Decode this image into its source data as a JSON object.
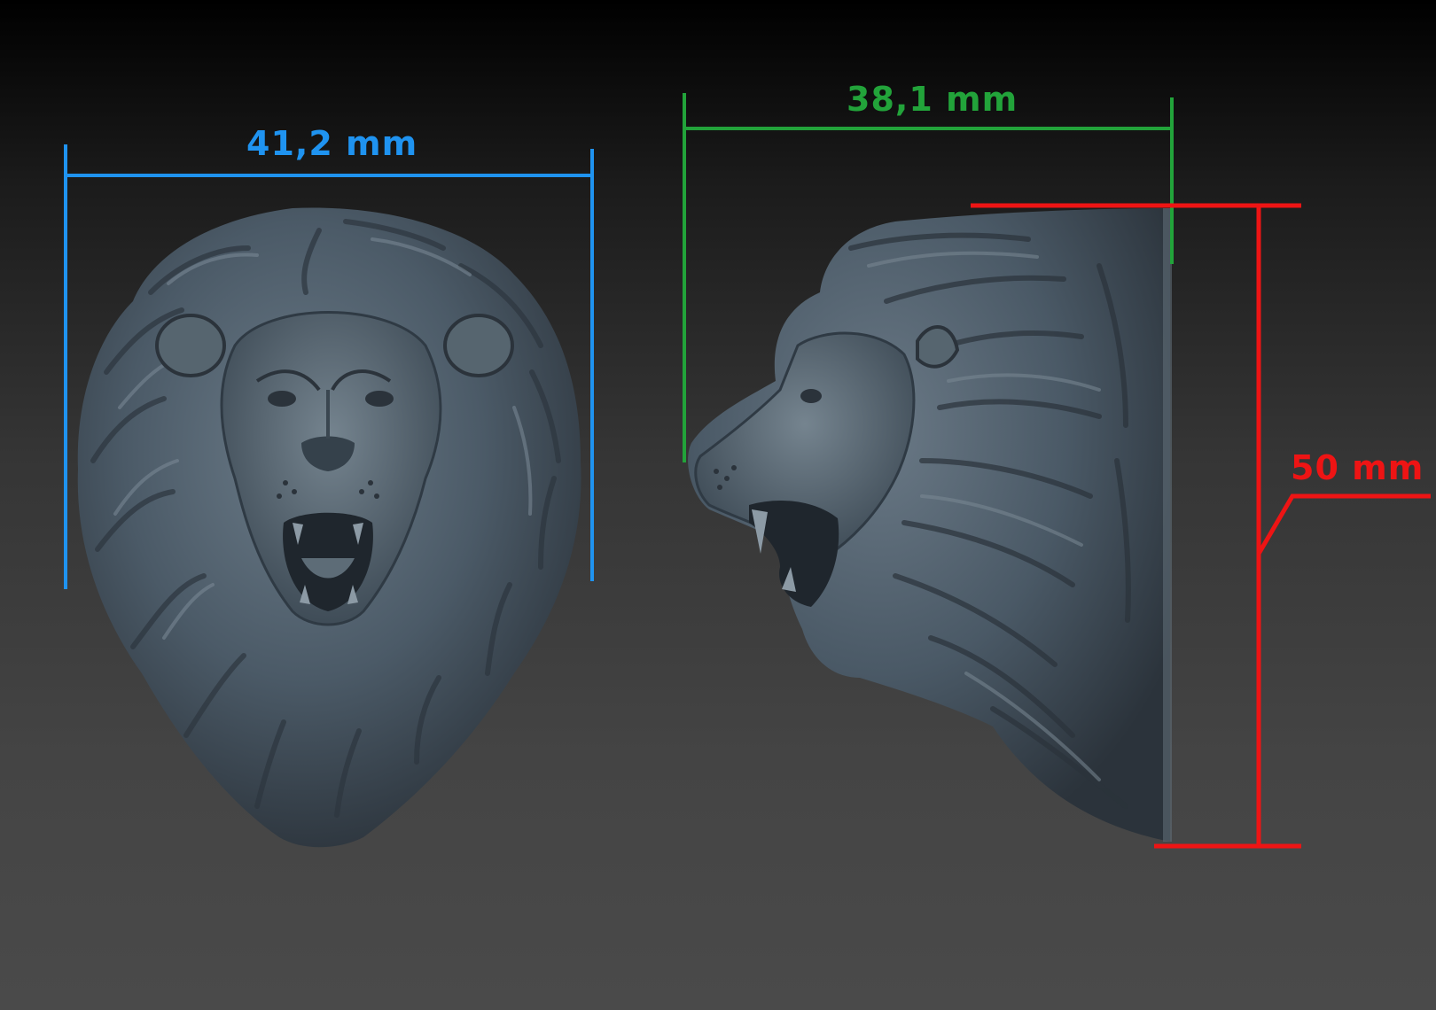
{
  "colors": {
    "background_top": "#000000",
    "background_bottom": "#4a4a4a",
    "model": "#4a5966",
    "width_front": "#1f93f0",
    "width_side": "#22a33a",
    "height": "#ee1414"
  },
  "dimensions": {
    "front_width": "41,2 mm",
    "side_depth": "38,1 mm",
    "height": "50 mm"
  },
  "views": {
    "front": "lion-head-front-render",
    "side": "lion-head-side-render"
  }
}
